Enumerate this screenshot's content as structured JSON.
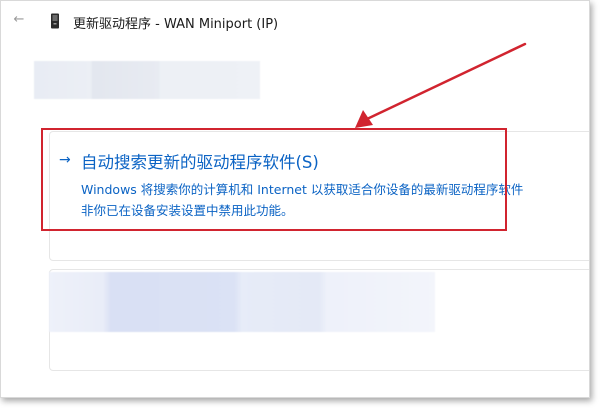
{
  "window": {
    "title": "更新驱动程序 - WAN Miniport (IP)",
    "back_glyph": "←",
    "device_icon": "device-icon"
  },
  "option_auto": {
    "arrow_glyph": "→",
    "title": "自动搜索更新的驱动程序软件(S)",
    "description_line1": "Windows 将搜索你的计算机和 Internet 以获取适合你设备的最新驱动程序软件",
    "description_line2": "非你已在设备安装设置中禁用此功能。"
  },
  "colors": {
    "link_blue": "#0b63c4",
    "annotation_red": "#d1242f"
  }
}
